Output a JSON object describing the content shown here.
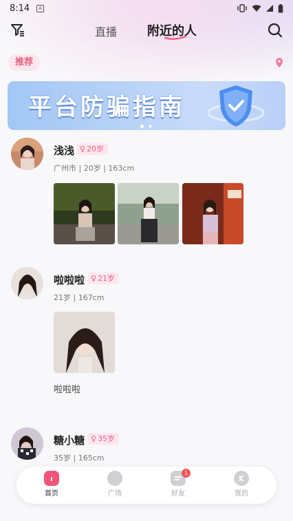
{
  "status_bar": {
    "time": "8:14",
    "notif_letter": "A"
  },
  "nav": {
    "tab_live": "直播",
    "tab_nearby": "附近的人"
  },
  "recommend_label": "推荐",
  "banner": {
    "title": "平台防骗指南",
    "page_count": 2,
    "active_page": 1
  },
  "users": [
    {
      "name": "浅浅",
      "age_badge": "20岁",
      "meta": "广州市 | 20岁 | 163cm",
      "photo_count": 3
    },
    {
      "name": "啦啦啦",
      "age_badge": "21岁",
      "meta": "21岁 | 167cm",
      "photo_count": 1,
      "caption": "啦啦啦"
    },
    {
      "name": "糖小糖",
      "age_badge": "35岁",
      "meta": "35岁 | 165cm"
    }
  ],
  "tabbar": {
    "items": [
      {
        "label": "首页",
        "icon": "home-icon",
        "active": true
      },
      {
        "label": "广场",
        "icon": "plaza-icon"
      },
      {
        "label": "好友",
        "icon": "friends-icon",
        "badge": "1"
      },
      {
        "label": "我的",
        "icon": "profile-icon"
      }
    ]
  },
  "colors": {
    "accent": "#ef5f85",
    "banner_blue": "#a3c7f5",
    "badge_red": "#f15454"
  }
}
